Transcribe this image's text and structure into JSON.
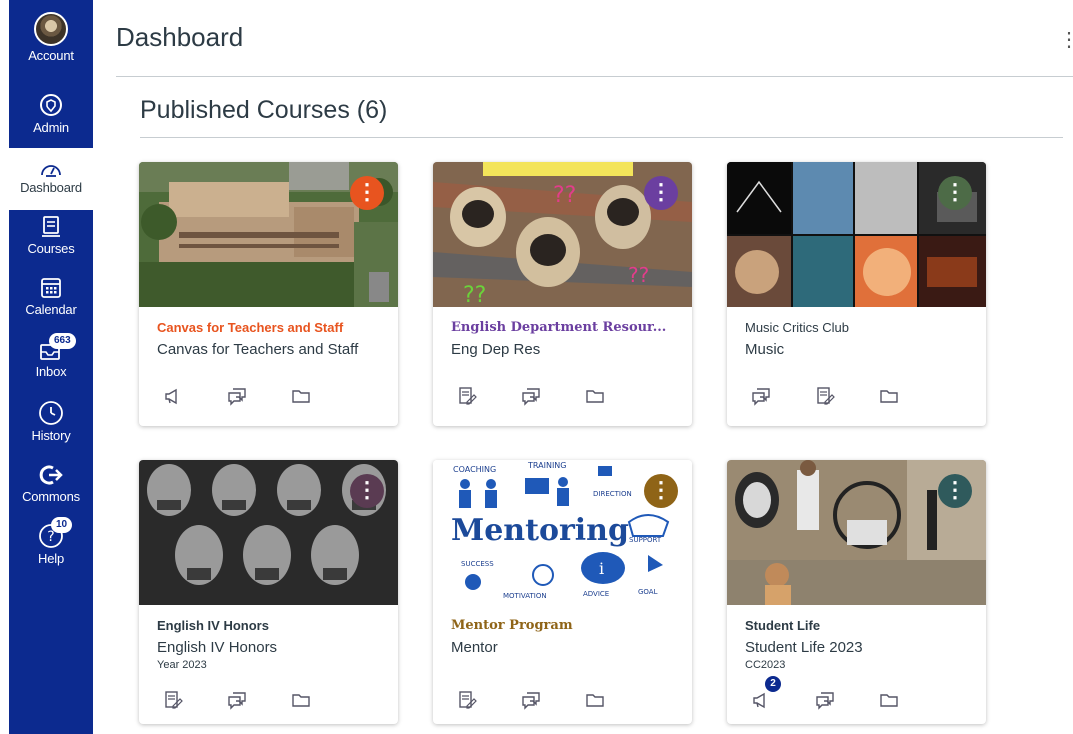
{
  "nav": {
    "account": "Account",
    "admin": "Admin",
    "dashboard": "Dashboard",
    "courses": "Courses",
    "calendar": "Calendar",
    "inbox": "Inbox",
    "inbox_badge": "663",
    "history": "History",
    "commons": "Commons",
    "help": "Help",
    "help_badge": "10"
  },
  "header": {
    "title": "Dashboard",
    "menu_glyph": "⋮"
  },
  "section": {
    "title": "Published Courses (6)"
  },
  "cards": [
    {
      "title": "Canvas for Teachers and Staff",
      "subtitle": "Canvas for Teachers and Staff",
      "term": "",
      "color": "#e8541f",
      "menu_glyph": "⋮",
      "actions": [
        "announcements-icon",
        "discussions-icon",
        "files-icon"
      ]
    },
    {
      "title": "English Department Resour...",
      "subtitle": "Eng Dep Res",
      "term": "",
      "color": "#6b3fa0",
      "menu_glyph": "⋮",
      "actions": [
        "assignments-icon",
        "discussions-icon",
        "files-icon"
      ]
    },
    {
      "title": "Music Critics Club",
      "subtitle": "Music",
      "term": "",
      "color": "#4d6b47",
      "menu_glyph": "⋮",
      "actions": [
        "discussions-icon",
        "assignments-icon",
        "files-icon"
      ]
    },
    {
      "title": "English IV Honors",
      "subtitle": "English IV Honors",
      "term": "Year 2023",
      "color": "#5a3b52",
      "menu_glyph": "⋮",
      "actions": [
        "assignments-icon",
        "discussions-icon",
        "files-icon"
      ]
    },
    {
      "title": "Mentor Program",
      "subtitle": "Mentor",
      "term": "",
      "color": "#8f6417",
      "menu_glyph": "⋮",
      "actions": [
        "assignments-icon",
        "discussions-icon",
        "files-icon"
      ]
    },
    {
      "title": "Student Life",
      "subtitle": "Student Life 2023",
      "term": "CC2023",
      "color": "#2f5a5c",
      "menu_glyph": "⋮",
      "actions": [
        "announcements-icon",
        "discussions-icon",
        "files-icon"
      ],
      "announcement_badge": "2"
    }
  ]
}
